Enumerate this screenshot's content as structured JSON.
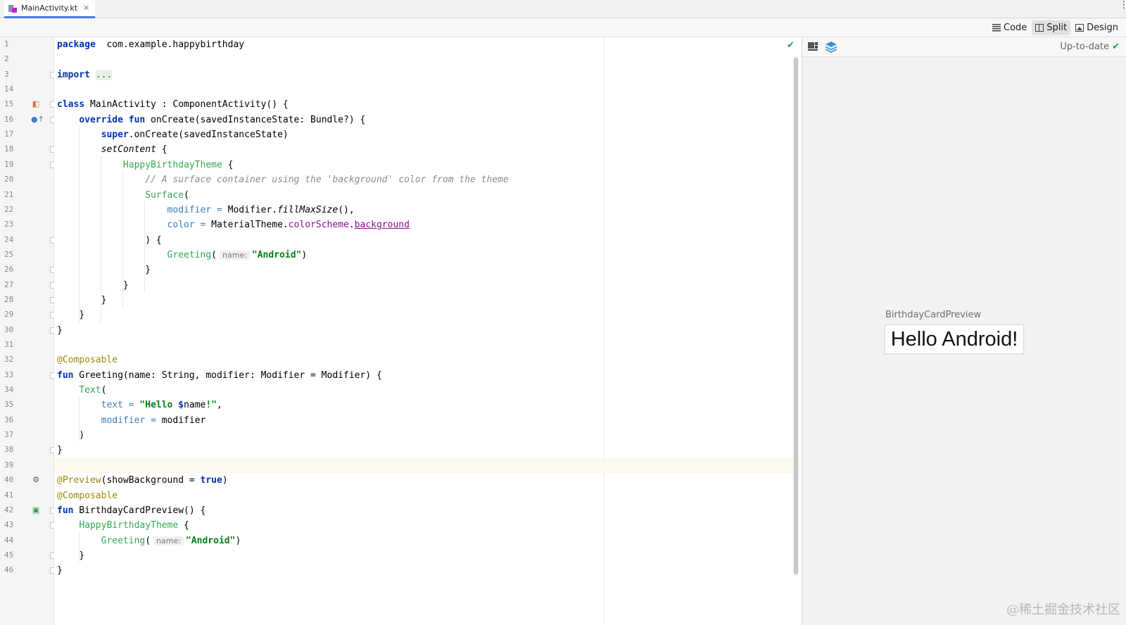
{
  "tab": {
    "filename": "MainActivity.kt",
    "close": "✕"
  },
  "menu": {
    "more": "⋮"
  },
  "modes": [
    {
      "label": "Code",
      "icon": "code-icon"
    },
    {
      "label": "Split",
      "icon": "split-icon",
      "active": true
    },
    {
      "label": "Design",
      "icon": "design-icon"
    }
  ],
  "editor": {
    "lines": [
      {
        "n": "1",
        "tokens": [
          [
            "kw",
            "package"
          ],
          [
            "",
            "  com.example.happybirthday"
          ]
        ]
      },
      {
        "n": "2",
        "tokens": []
      },
      {
        "n": "3",
        "fold": true,
        "tokens": [
          [
            "kw",
            "import"
          ],
          [
            "",
            " "
          ],
          [
            "importdots",
            "..."
          ]
        ]
      },
      {
        "n": "14",
        "tokens": []
      },
      {
        "n": "15",
        "fold": true,
        "icon": "class-icon",
        "tokens": [
          [
            "kw",
            "class"
          ],
          [
            "",
            " MainActivity : ComponentActivity() {"
          ]
        ]
      },
      {
        "n": "16",
        "fold": true,
        "icon": "override-icon",
        "tokens": [
          [
            "",
            "    "
          ],
          [
            "kw",
            "override fun"
          ],
          [
            "",
            " onCreate(savedInstanceState: Bundle?) {"
          ]
        ]
      },
      {
        "n": "17",
        "tokens": [
          [
            "",
            "        "
          ],
          [
            "kw",
            "super"
          ],
          [
            "",
            ".onCreate(savedInstanceState)"
          ]
        ]
      },
      {
        "n": "18",
        "fold": true,
        "tokens": [
          [
            "",
            "        "
          ],
          [
            "italic",
            "setContent"
          ],
          [
            "",
            " {"
          ]
        ]
      },
      {
        "n": "19",
        "fold": true,
        "tokens": [
          [
            "",
            "            "
          ],
          [
            "compo",
            "HappyBirthdayTheme"
          ],
          [
            "",
            " {"
          ]
        ]
      },
      {
        "n": "20",
        "tokens": [
          [
            "",
            "                "
          ],
          [
            "cmt",
            "// A surface container using the 'background' color from the theme"
          ]
        ]
      },
      {
        "n": "21",
        "tokens": [
          [
            "",
            "                "
          ],
          [
            "compo",
            "Surface"
          ],
          [
            "",
            "("
          ]
        ]
      },
      {
        "n": "22",
        "tokens": [
          [
            "",
            "                    "
          ],
          [
            "param",
            "modifier"
          ],
          [
            "param",
            " ="
          ],
          [
            "",
            " Modifier."
          ],
          [
            "italic",
            "fillMaxSize"
          ],
          [
            "",
            "(),"
          ]
        ]
      },
      {
        "n": "23",
        "tokens": [
          [
            "",
            "                    "
          ],
          [
            "param",
            "color"
          ],
          [
            "param",
            " ="
          ],
          [
            "",
            " MaterialTheme."
          ],
          [
            "prop",
            "colorScheme"
          ],
          [
            "",
            "."
          ],
          [
            "propu",
            "background"
          ]
        ]
      },
      {
        "n": "24",
        "fold": true,
        "tokens": [
          [
            "",
            "                ) {"
          ]
        ]
      },
      {
        "n": "25",
        "tokens": [
          [
            "",
            "                    "
          ],
          [
            "compo",
            "Greeting"
          ],
          [
            "",
            "("
          ],
          [
            "hint",
            "name:"
          ],
          [
            "str",
            "\"Android\""
          ],
          [
            "",
            ")"
          ]
        ]
      },
      {
        "n": "26",
        "fold": true,
        "tokens": [
          [
            "",
            "                }"
          ]
        ]
      },
      {
        "n": "27",
        "fold": true,
        "tokens": [
          [
            "",
            "            }"
          ]
        ]
      },
      {
        "n": "28",
        "fold": true,
        "tokens": [
          [
            "",
            "        }"
          ]
        ]
      },
      {
        "n": "29",
        "fold": true,
        "tokens": [
          [
            "",
            "    }"
          ]
        ]
      },
      {
        "n": "30",
        "fold": true,
        "tokens": [
          [
            "",
            "}"
          ]
        ]
      },
      {
        "n": "31",
        "tokens": []
      },
      {
        "n": "32",
        "tokens": [
          [
            "ann",
            "@Composable"
          ]
        ]
      },
      {
        "n": "33",
        "fold": true,
        "tokens": [
          [
            "kw",
            "fun"
          ],
          [
            "",
            " Greeting(name: String, modifier: Modifier = Modifier) {"
          ]
        ]
      },
      {
        "n": "34",
        "tokens": [
          [
            "",
            "    "
          ],
          [
            "compo",
            "Text"
          ],
          [
            "",
            "("
          ]
        ]
      },
      {
        "n": "35",
        "tokens": [
          [
            "",
            "        "
          ],
          [
            "param",
            "text"
          ],
          [
            "param",
            " ="
          ],
          [
            "",
            " "
          ],
          [
            "str",
            "\"Hello "
          ],
          [
            "kw",
            "$"
          ],
          [
            "",
            "name"
          ],
          [
            "str",
            "!\""
          ],
          [
            "",
            ","
          ]
        ]
      },
      {
        "n": "36",
        "tokens": [
          [
            "",
            "        "
          ],
          [
            "param",
            "modifier"
          ],
          [
            "param",
            " ="
          ],
          [
            "",
            " modifier"
          ]
        ]
      },
      {
        "n": "37",
        "tokens": [
          [
            "",
            "    )"
          ]
        ]
      },
      {
        "n": "38",
        "fold": true,
        "tokens": [
          [
            "",
            "}"
          ]
        ]
      },
      {
        "n": "39",
        "current": true,
        "tokens": []
      },
      {
        "n": "40",
        "icon": "gear-icon",
        "tokens": [
          [
            "ann",
            "@Preview"
          ],
          [
            "",
            "(showBackground = "
          ],
          [
            "kw",
            "true"
          ],
          [
            "",
            ")"
          ]
        ]
      },
      {
        "n": "41",
        "tokens": [
          [
            "ann",
            "@Composable"
          ]
        ]
      },
      {
        "n": "42",
        "fold": true,
        "icon": "run-preview-icon",
        "tokens": [
          [
            "kw",
            "fun"
          ],
          [
            "",
            " BirthdayCardPreview() {"
          ]
        ]
      },
      {
        "n": "43",
        "fold": true,
        "tokens": [
          [
            "",
            "    "
          ],
          [
            "compo",
            "HappyBirthdayTheme"
          ],
          [
            "",
            " {"
          ]
        ]
      },
      {
        "n": "44",
        "tokens": [
          [
            "",
            "        "
          ],
          [
            "compo",
            "Greeting"
          ],
          [
            "",
            "("
          ],
          [
            "hint",
            "name:"
          ],
          [
            "str",
            "\"Android\""
          ],
          [
            "",
            ")"
          ]
        ]
      },
      {
        "n": "45",
        "fold": true,
        "tokens": [
          [
            "",
            "    }"
          ]
        ]
      },
      {
        "n": "46",
        "fold": true,
        "tokens": [
          [
            "",
            "}"
          ]
        ]
      }
    ]
  },
  "preview": {
    "status": "Up-to-date",
    "status_icon": "checkmark-icon",
    "label": "BirthdayCardPreview",
    "card_text": "Hello Android!"
  },
  "watermark": "@稀土掘金技术社区",
  "colors": {
    "accent": "#4a7ad9",
    "ok": "#1f9e3a",
    "keyword": "#0033b3",
    "string": "#067d17",
    "annotation": "#9e880d"
  }
}
